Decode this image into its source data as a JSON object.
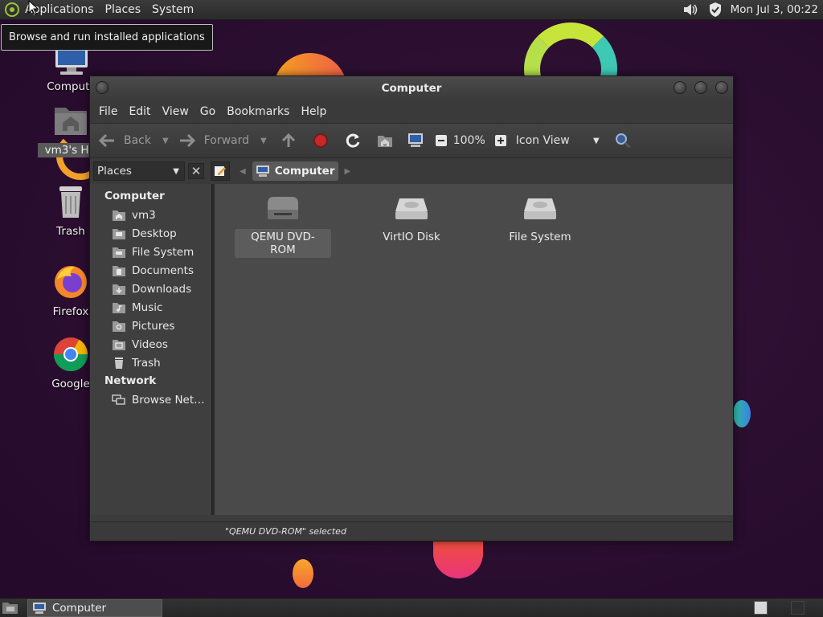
{
  "top_panel": {
    "menus": [
      "Applications",
      "Places",
      "System"
    ],
    "clock": "Mon Jul 3, 00:22"
  },
  "tooltip": "Browse and run installed applications",
  "desktop_icons": [
    {
      "label": "Compute",
      "icon": "computer-icon"
    },
    {
      "label": "vm3's Hor",
      "icon": "home-folder-icon"
    },
    {
      "label": "Trash",
      "icon": "trash-icon"
    },
    {
      "label": "Firefox",
      "icon": "firefox-icon"
    },
    {
      "label": "Google",
      "icon": "chrome-icon"
    }
  ],
  "window": {
    "title": "Computer",
    "menus": [
      "File",
      "Edit",
      "View",
      "Go",
      "Bookmarks",
      "Help"
    ],
    "toolbar": {
      "back": "Back",
      "forward": "Forward",
      "zoom": "100%",
      "view_mode": "Icon View"
    },
    "places_select": "Places",
    "breadcrumb": "Computer",
    "sidebar": {
      "computer_header": "Computer",
      "computer_items": [
        "vm3",
        "Desktop",
        "File System",
        "Documents",
        "Downloads",
        "Music",
        "Pictures",
        "Videos",
        "Trash"
      ],
      "network_header": "Network",
      "network_items": [
        "Browse Net…"
      ]
    },
    "items": [
      {
        "label": "QEMU DVD-ROM",
        "icon": "optical-drive-icon",
        "selected": true
      },
      {
        "label": "VirtIO Disk",
        "icon": "hard-disk-icon",
        "selected": false
      },
      {
        "label": "File System",
        "icon": "hard-disk-icon",
        "selected": false
      }
    ],
    "status": "\"QEMU DVD-ROM\" selected"
  },
  "taskbar": {
    "task": "Computer"
  }
}
